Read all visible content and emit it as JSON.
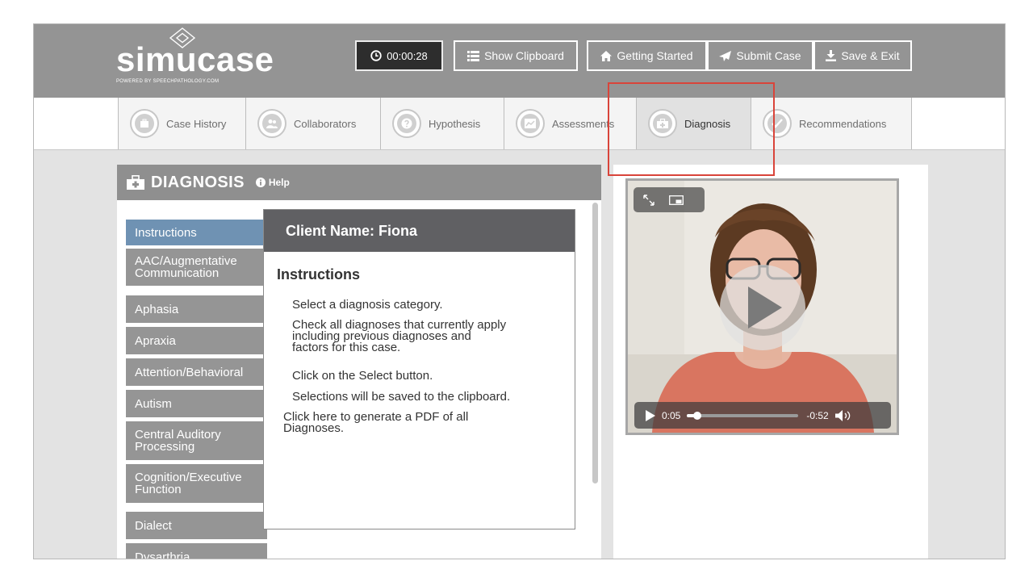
{
  "logo": {
    "word": "simucase",
    "tm": "®",
    "tagline": "POWERED BY SPEECHPATHOLOGY.COM"
  },
  "header": {
    "timer": "00:00:28",
    "show_clipboard": "Show Clipboard",
    "getting_started": "Getting Started",
    "submit_case": "Submit Case",
    "save_exit": "Save & Exit"
  },
  "tabs": [
    {
      "label": "Case History",
      "icon": "briefcase-icon",
      "active": false
    },
    {
      "label": "Collaborators",
      "icon": "people-icon",
      "active": false
    },
    {
      "label": "Hypothesis",
      "icon": "question-icon",
      "active": false
    },
    {
      "label": "Assessments",
      "icon": "chart-icon",
      "active": false
    },
    {
      "label": "Diagnosis",
      "icon": "medkit-icon",
      "active": true
    },
    {
      "label": "Recommendations",
      "icon": "check-icon",
      "active": false
    }
  ],
  "panel": {
    "title": "DIAGNOSIS",
    "help": "Help"
  },
  "categories": [
    "Instructions",
    "AAC/Augmentative\nCommunication",
    "Aphasia",
    "Apraxia",
    "Attention/Behavioral",
    "Autism",
    "Central Auditory\nProcessing",
    "Cognition/Executive\nFunction",
    "Dialect",
    "Dysarthria"
  ],
  "active_category": 0,
  "info": {
    "client_label": "Client Name: Fiona",
    "heading": "Instructions",
    "steps": [
      "Select a diagnosis category.",
      "Check all diagnoses that currently apply\nincluding previous diagnoses and\nfactors for this case.",
      "Click on the Select button.",
      "Selections will be saved to the clipboard."
    ],
    "pdf_link": "Click here to generate a PDF of all\nDiagnoses."
  },
  "video": {
    "current_time": "0:05",
    "remaining_time": "-0:52",
    "progress": 0.09
  },
  "colors": {
    "header_bg": "#949494",
    "active_category": "#6f92b3",
    "highlight": "#d9443a",
    "info_header": "#606063"
  }
}
